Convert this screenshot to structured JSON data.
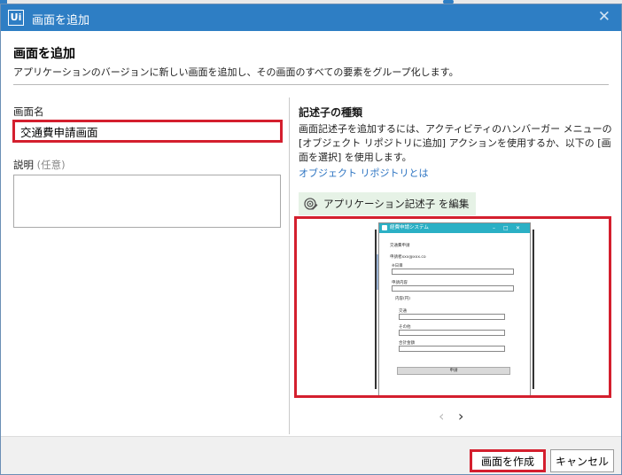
{
  "dialog": {
    "title": "画面を追加",
    "logo_text": "Ui",
    "close_glyph": "✕"
  },
  "header": {
    "heading": "画面を追加",
    "description": "アプリケーションのバージョンに新しい画面を追加し、その画面のすべての要素をグループ化します。"
  },
  "left": {
    "name_label": "画面名",
    "name_value": "交通費申請画面",
    "desc_label": "説明",
    "desc_optional": "(任意)",
    "desc_value": ""
  },
  "right": {
    "heading": "記述子の種類",
    "description": "画面記述子を追加するには、アクティビティのハンバーガー メニューの [オブジェクト リポジトリに追加] アクションを使用するか、以下の [画面を選択] を使用します。",
    "link": "オブジェクト リポジトリとは",
    "edit_button": "アプリケーション記述子 を編集",
    "edit_icon": "target-edit-icon"
  },
  "preview": {
    "window_title": "経費申請システム",
    "controls": [
      "–",
      "□",
      "✕"
    ],
    "heading": "交通費申請",
    "email": "申請者xxx@xxx.co",
    "date_label": "※日目",
    "route_label": "申請内容",
    "group_label": "内容(円)",
    "field1_label": "交通",
    "field2_label": "その他",
    "field3_label": "合計金額",
    "submit": "申請"
  },
  "nav": {
    "prev": "‹",
    "next": "›"
  },
  "footer": {
    "create_label": "画面を作成",
    "cancel_label": "キャンセル"
  },
  "colors": {
    "titlebar": "#2e7ec4",
    "highlight": "#d41f2e",
    "link": "#2d74c2",
    "edit_bg": "#e6f2e6",
    "preview_titlebar": "#2bb0c5"
  }
}
